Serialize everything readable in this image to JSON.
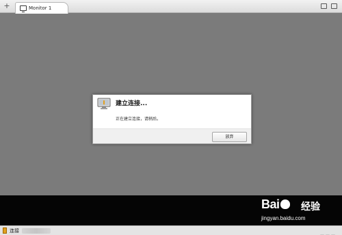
{
  "tabbar": {
    "add_label": "+",
    "active_tab": {
      "label": "Monitor 1",
      "icon": "monitor-icon"
    },
    "right_icons": [
      "window-icon",
      "screen-icon"
    ]
  },
  "dialog": {
    "icon": "monitor-connecting-icon",
    "title": "建立连接...",
    "message": "正在建立连接，请稍后。",
    "button_label": "放弃"
  },
  "statusbar": {
    "icon": "status-warning-icon",
    "text": "连接"
  },
  "watermark": {
    "logo_text": "Bai du",
    "cn_text": "经验",
    "url": "jingyan.baidu.com"
  }
}
